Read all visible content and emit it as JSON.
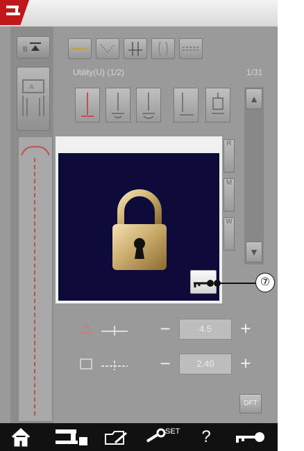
{
  "screen": {
    "mode_title": "Utility(U) (1/2)",
    "page": "1/31"
  },
  "scroll": {
    "up": "▲",
    "down": "▼"
  },
  "side_tabs": [
    "R",
    "M",
    "W"
  ],
  "params": [
    {
      "name": "width",
      "value": "4.5",
      "minus": "−",
      "plus": "+"
    },
    {
      "name": "length",
      "value": "2.40",
      "minus": "−",
      "plus": "+"
    }
  ],
  "dft_label": "DFT",
  "nav": {
    "home": "⌂",
    "set_label": "SET",
    "help": "?"
  },
  "callout": {
    "number": "⑦"
  },
  "colors": {
    "accent_red": "#c01818",
    "lock_gold": "#c8a868",
    "dialog_bg": "#0c0b3a"
  }
}
